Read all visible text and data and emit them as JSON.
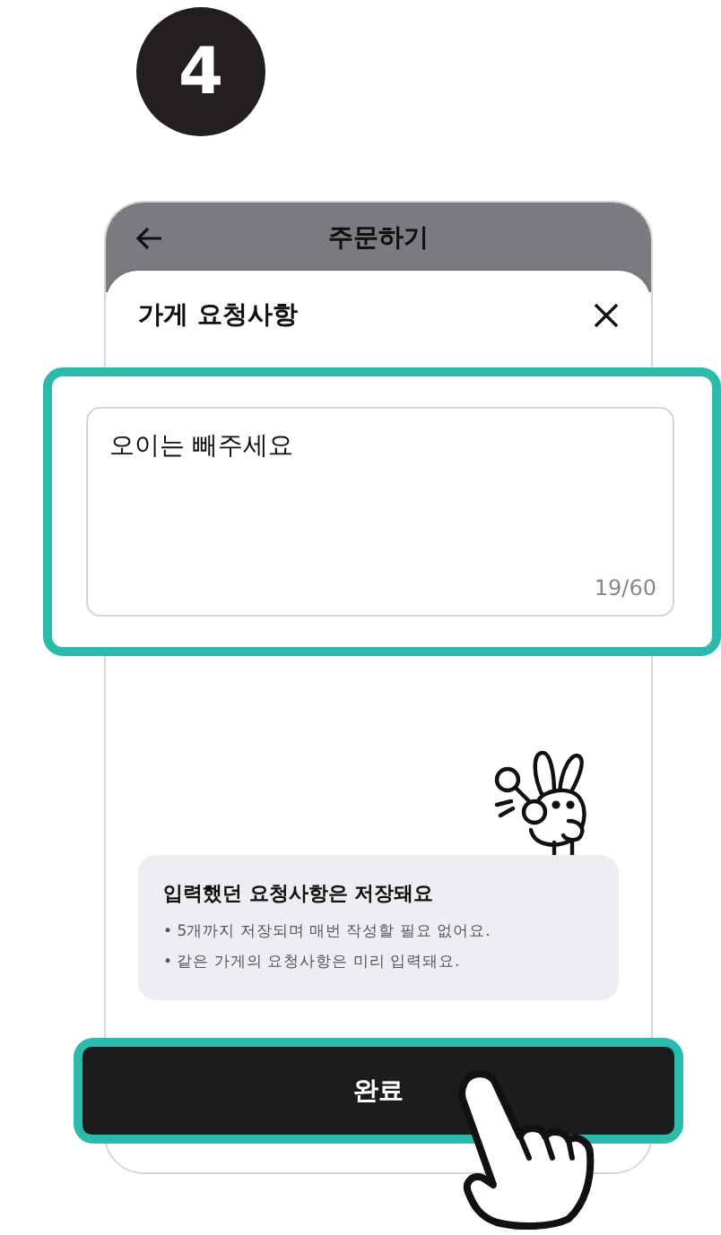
{
  "step_badge": "4",
  "screen": {
    "title": "주문하기"
  },
  "sheet": {
    "title": "가게 요청사항"
  },
  "request_field": {
    "value": "오이는 빼주세요",
    "counter": "19/60"
  },
  "info": {
    "title": "입력했던 요청사항은 저장돼요",
    "bullets": [
      "• 5개까지 저장되며 매번 작성할 필요 없어요.",
      "• 같은 가게의 요청사항은 미리 입력돼요."
    ]
  },
  "button": {
    "label": "완료"
  }
}
